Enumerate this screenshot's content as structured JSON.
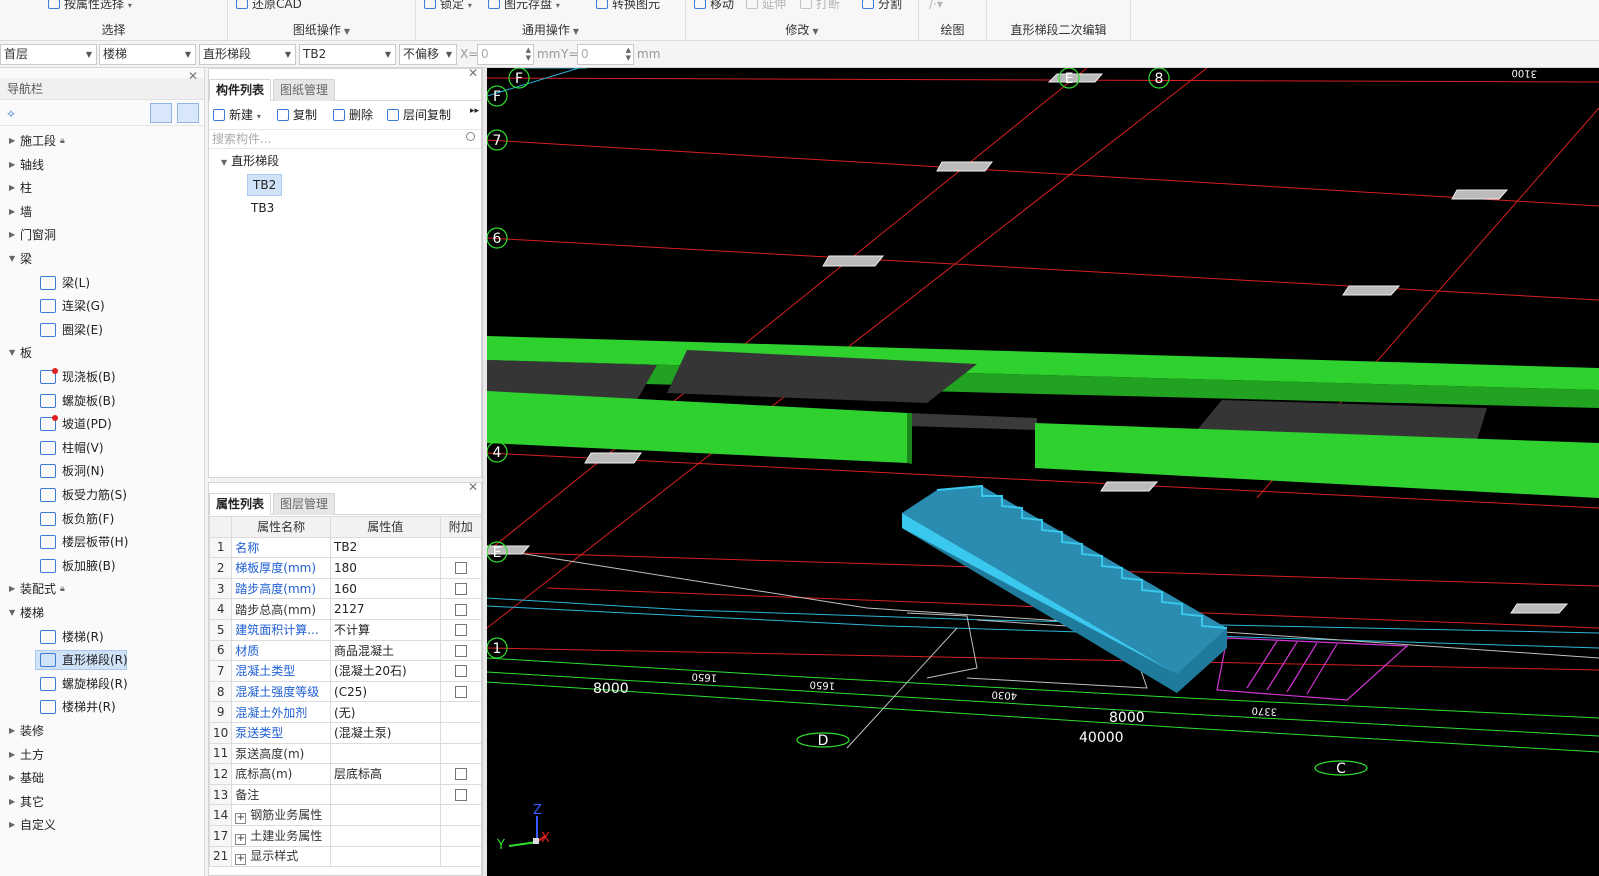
{
  "ribbon": {
    "groups": [
      {
        "label": "选择",
        "tools": [
          "按属性选择"
        ]
      },
      {
        "label": "图纸操作",
        "tools": [
          "还原CAD"
        ]
      },
      {
        "label": "通用操作",
        "tools": [
          "锁定",
          "图元存盘",
          "转换图元"
        ]
      },
      {
        "label": "修改",
        "tools": [
          "移动",
          "延伸",
          "打断",
          "分割"
        ]
      },
      {
        "label": "绘图",
        "tools": []
      },
      {
        "label": "直形梯段二次编辑",
        "tools": []
      }
    ]
  },
  "selector": {
    "floor": "首层",
    "category": "楼梯",
    "type": "直形梯段",
    "component": "TB2",
    "offset": "不偏移",
    "x_label": "X=",
    "x_value": "0",
    "mm1": "mm",
    "y_label": "Y=",
    "y_value": "0",
    "mm2": "mm"
  },
  "nav": {
    "title": "导航栏",
    "items": [
      {
        "label": "施工段",
        "lock": true,
        "level": 0,
        "expanded": false
      },
      {
        "label": "轴线",
        "level": 0,
        "expanded": false
      },
      {
        "label": "柱",
        "level": 0,
        "expanded": false
      },
      {
        "label": "墙",
        "level": 0,
        "expanded": false
      },
      {
        "label": "门窗洞",
        "level": 0,
        "expanded": false
      },
      {
        "label": "梁",
        "level": 0,
        "expanded": true
      },
      {
        "label": "梁(L)",
        "level": 1
      },
      {
        "label": "连梁(G)",
        "level": 1
      },
      {
        "label": "圈梁(E)",
        "level": 1
      },
      {
        "label": "板",
        "level": 0,
        "expanded": true
      },
      {
        "label": "现浇板(B)",
        "level": 1,
        "dot": true
      },
      {
        "label": "螺旋板(B)",
        "level": 1
      },
      {
        "label": "坡道(PD)",
        "level": 1,
        "dot": true
      },
      {
        "label": "柱帽(V)",
        "level": 1
      },
      {
        "label": "板洞(N)",
        "level": 1
      },
      {
        "label": "板受力筋(S)",
        "level": 1
      },
      {
        "label": "板负筋(F)",
        "level": 1
      },
      {
        "label": "楼层板带(H)",
        "level": 1
      },
      {
        "label": "板加腋(B)",
        "level": 1
      },
      {
        "label": "装配式",
        "lock": true,
        "level": 0,
        "expanded": false
      },
      {
        "label": "楼梯",
        "level": 0,
        "expanded": true
      },
      {
        "label": "楼梯(R)",
        "level": 1
      },
      {
        "label": "直形梯段(R)",
        "level": 1,
        "selected": true
      },
      {
        "label": "螺旋梯段(R)",
        "level": 1
      },
      {
        "label": "楼梯井(R)",
        "level": 1
      },
      {
        "label": "装修",
        "level": 0,
        "expanded": false
      },
      {
        "label": "土方",
        "level": 0,
        "expanded": false
      },
      {
        "label": "基础",
        "level": 0,
        "expanded": false
      },
      {
        "label": "其它",
        "level": 0,
        "expanded": false
      },
      {
        "label": "自定义",
        "level": 0,
        "expanded": false
      }
    ]
  },
  "components": {
    "tab_active": "构件列表",
    "tab_other": "图纸管理",
    "toolbar": {
      "new": "新建",
      "copy": "复制",
      "delete": "删除",
      "floor_copy": "层间复制"
    },
    "search_placeholder": "搜索构件...",
    "group": "直形梯段",
    "items": [
      "TB2",
      "TB3"
    ]
  },
  "properties": {
    "tab_active": "属性列表",
    "tab_other": "图层管理",
    "headers": [
      "属性名称",
      "属性值",
      "附加"
    ],
    "rows": [
      {
        "idx": "1",
        "name": "名称",
        "value": "TB2",
        "blue": true,
        "check": false
      },
      {
        "idx": "2",
        "name": "梯板厚度(mm)",
        "value": "180",
        "blue": true,
        "check": true
      },
      {
        "idx": "3",
        "name": "踏步高度(mm)",
        "value": "160",
        "blue": true,
        "check": true
      },
      {
        "idx": "4",
        "name": "踏步总高(mm)",
        "value": "2127",
        "blue": false,
        "check": true
      },
      {
        "idx": "5",
        "name": "建筑面积计算...",
        "value": "不计算",
        "blue": true,
        "check": true
      },
      {
        "idx": "6",
        "name": "材质",
        "value": "商品混凝土",
        "blue": true,
        "check": true
      },
      {
        "idx": "7",
        "name": "混凝土类型",
        "value": "(混凝土20石)",
        "blue": true,
        "check": true
      },
      {
        "idx": "8",
        "name": "混凝土强度等级",
        "value": "(C25)",
        "blue": true,
        "check": true
      },
      {
        "idx": "9",
        "name": "混凝土外加剂",
        "value": "(无)",
        "blue": true,
        "check": false
      },
      {
        "idx": "10",
        "name": "泵送类型",
        "value": "(混凝土泵)",
        "blue": true,
        "check": false
      },
      {
        "idx": "11",
        "name": "泵送高度(m)",
        "value": "",
        "blue": false,
        "check": false
      },
      {
        "idx": "12",
        "name": "底标高(m)",
        "value": "层底标高",
        "blue": false,
        "check": true
      },
      {
        "idx": "13",
        "name": "备注",
        "value": "",
        "blue": false,
        "check": true
      },
      {
        "idx": "14",
        "name": "钢筋业务属性",
        "value": "",
        "blue": false,
        "check": false,
        "expand": true
      },
      {
        "idx": "17",
        "name": "土建业务属性",
        "value": "",
        "blue": false,
        "check": false,
        "expand": true
      },
      {
        "idx": "21",
        "name": "显示样式",
        "value": "",
        "blue": false,
        "check": false,
        "expand": true
      }
    ]
  },
  "canvas": {
    "axis_labels": [
      "F",
      "F",
      "E",
      "8",
      "7",
      "6",
      "4",
      "E",
      "1",
      "D",
      "C"
    ],
    "dims": [
      "8000",
      "8000",
      "40000",
      "3100",
      "1650",
      "1650",
      "4030",
      "3370"
    ],
    "triad": {
      "z": "Z",
      "y": "Y",
      "x": "X"
    },
    "colors": {
      "slab": "#2ed12e",
      "stair": "#2fb3df",
      "axis": "#e02626",
      "dim": "#2ee02e",
      "magenta": "#d236d2"
    }
  }
}
